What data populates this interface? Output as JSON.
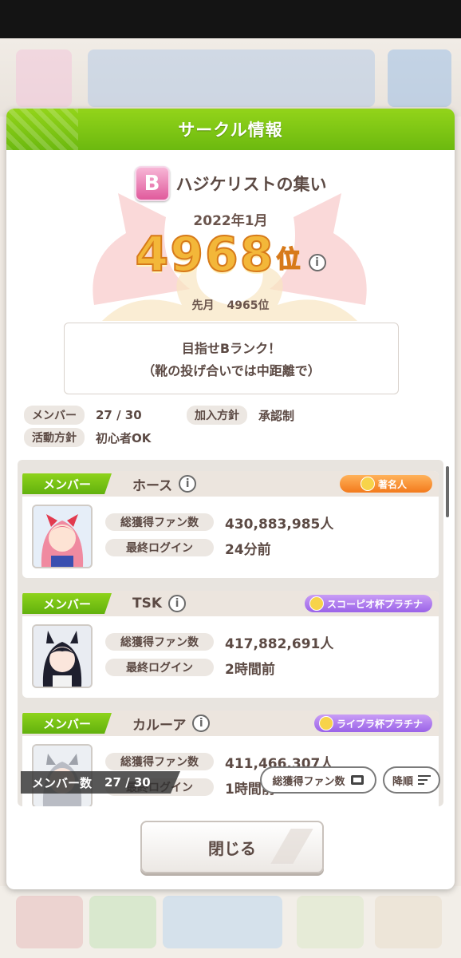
{
  "dialog": {
    "title": "サークル情報"
  },
  "circle": {
    "rank_letter": "B",
    "name": "ハジケリストの集い",
    "month": "2022年1月",
    "rank": "4968",
    "rank_suffix": "位",
    "prev_label": "先月",
    "prev_rank": "4965位",
    "message_line1": "目指せBランク！",
    "message_line2": "（靴の投げ合いでは中距離で）",
    "members_label": "メンバー",
    "members_value": "27 / 30",
    "join_label": "加入方針",
    "join_value": "承認制",
    "activity_label": "活動方針",
    "activity_value": "初心者OK"
  },
  "members": [
    {
      "role": "メンバー",
      "name": "ホース",
      "title": "著名人",
      "fans_label": "総獲得ファン数",
      "fans": "430,883,985人",
      "login_label": "最終ログイン",
      "login": "24分前"
    },
    {
      "role": "メンバー",
      "name": "TSK",
      "title": "スコーピオ杯プラチナ",
      "fans_label": "総獲得ファン数",
      "fans": "417,882,691人",
      "login_label": "最終ログイン",
      "login": "2時間前"
    },
    {
      "role": "メンバー",
      "name": "カルーア",
      "title": "ライブラ杯プラチナ",
      "fans_label": "総獲得ファン数",
      "fans": "411,466,307人",
      "login_label": "最終ログイン",
      "login": "1時間前"
    }
  ],
  "list_footer": {
    "count_label": "メンバー数",
    "count_value": "27 / 30",
    "sort_key": "総獲得ファン数",
    "sort_order": "降順"
  },
  "close_label": "閉じる",
  "colors": {
    "header_green": "#7ac414",
    "rank_gold": "#f3b739",
    "text_brown": "#5c4a44"
  },
  "icons": [
    "info-icon",
    "rank-b-badge",
    "title-badge-icon",
    "card-icon",
    "sort-icon"
  ]
}
